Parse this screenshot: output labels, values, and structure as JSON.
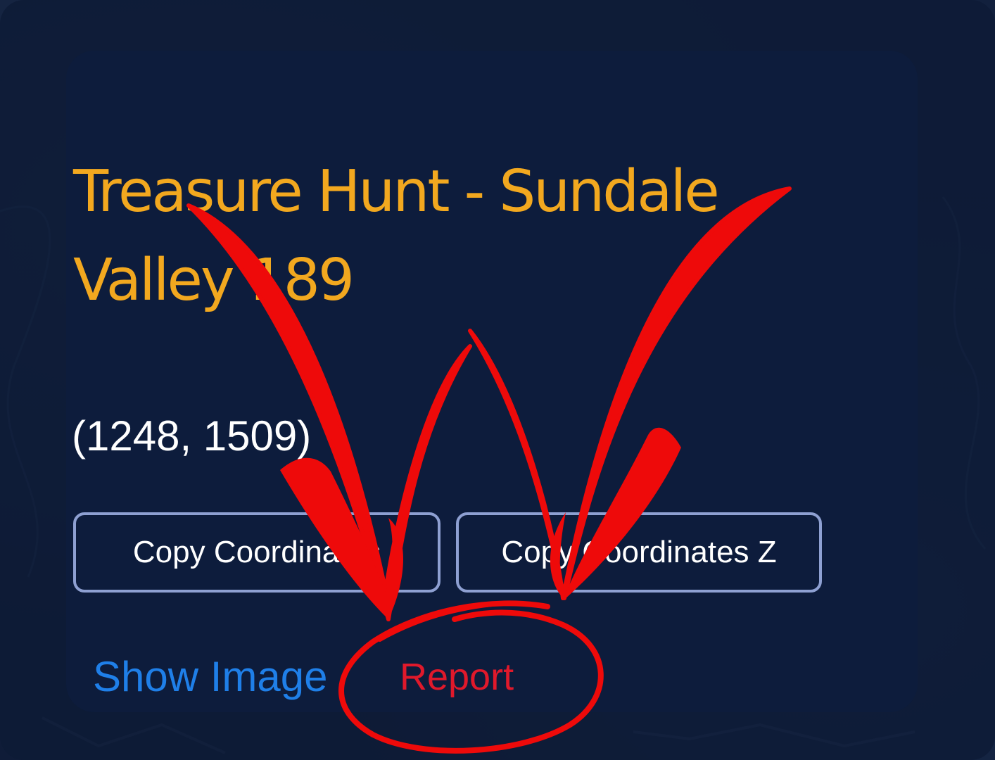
{
  "card": {
    "title": "Treasure Hunt - Sundale Valley 189",
    "coordinates": "(1248, 1509)",
    "buttons": {
      "copy_coordinates": "Copy Coordinates",
      "copy_coordinates_z": "Copy Coordinates Z"
    },
    "links": {
      "show_image": "Show Image",
      "report": "Report"
    }
  },
  "colors": {
    "title": "#f2a81f",
    "link": "#1f7fe8",
    "report": "#e0192b",
    "annotation": "#ee0a0a",
    "button_border": "#8ea0d2",
    "card_background": "#0d1c3c"
  },
  "annotation": {
    "shapes": [
      "left-arrow",
      "right-arrow",
      "circle"
    ],
    "target": "report-link"
  }
}
